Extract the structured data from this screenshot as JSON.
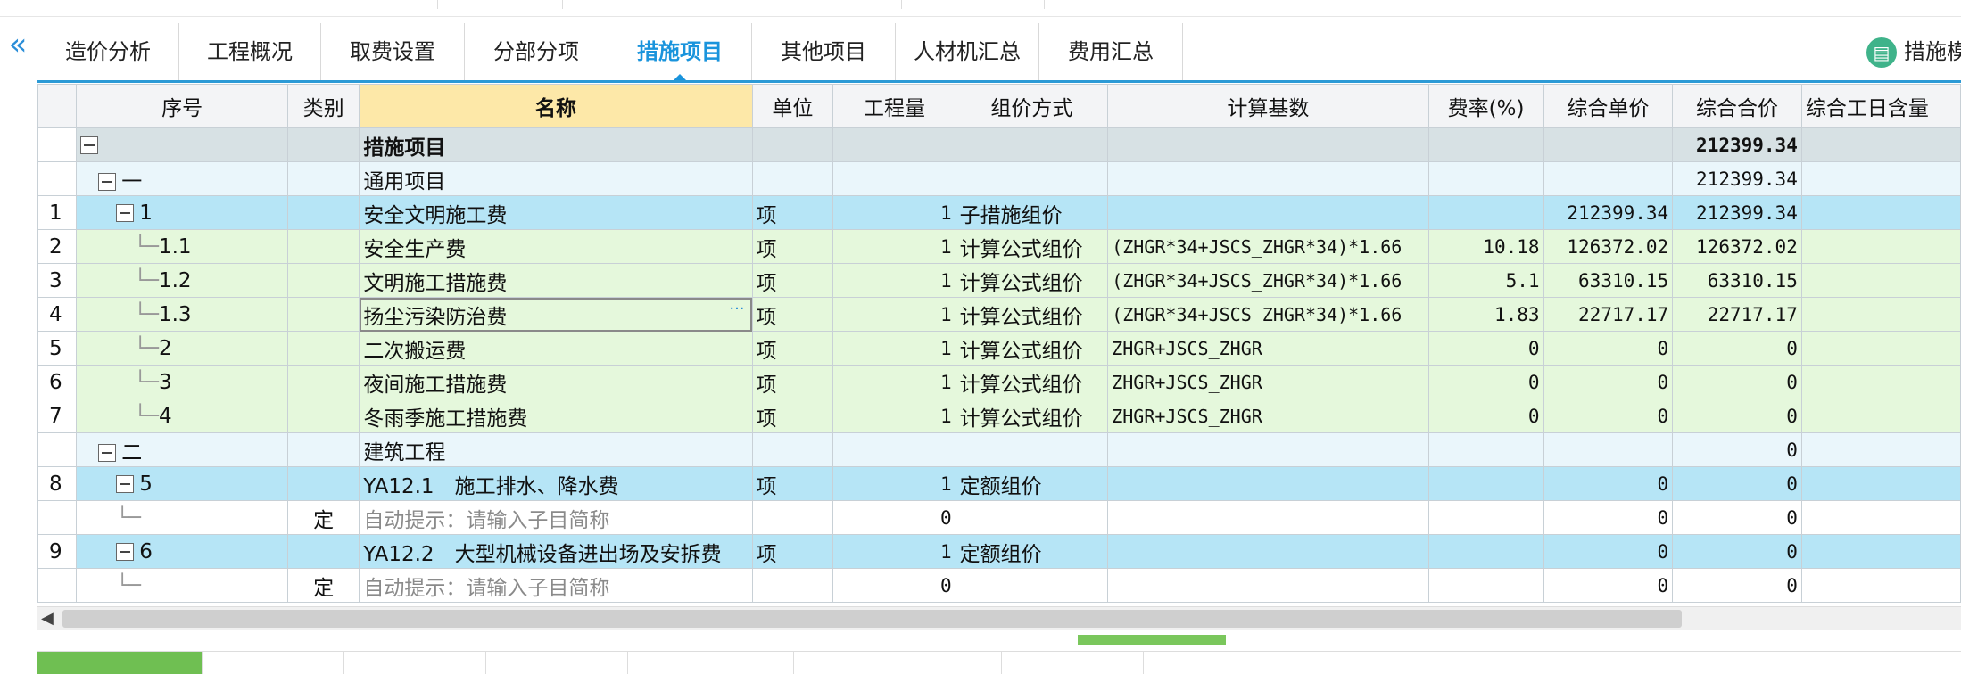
{
  "tabs": [
    {
      "label": "造价分析"
    },
    {
      "label": "工程概况"
    },
    {
      "label": "取费设置"
    },
    {
      "label": "分部分项"
    },
    {
      "label": "措施项目",
      "active": true
    },
    {
      "label": "其他项目"
    },
    {
      "label": "人材机汇总"
    },
    {
      "label": "费用汇总"
    }
  ],
  "top_right": {
    "label": "措施模",
    "icon": "book-icon"
  },
  "collapse_icon": "double-chevron-left-icon",
  "columns": [
    "序号",
    "类别",
    "名称",
    "单位",
    "工程量",
    "组价方式",
    "计算基数",
    "费率(%)",
    "综合单价",
    "综合合价",
    "综合工日含量"
  ],
  "rows": [
    {
      "no": "",
      "code": "",
      "type": "",
      "name": "措施项目",
      "unit": "",
      "qty": "",
      "method": "",
      "base": "",
      "rate": "",
      "price": "",
      "total": "212399.34",
      "level": "level0",
      "bold": true
    },
    {
      "no": "",
      "code": "一",
      "type": "",
      "name": "通用项目",
      "unit": "",
      "qty": "",
      "method": "",
      "base": "",
      "rate": "",
      "price": "",
      "total": "212399.34",
      "level": "level1"
    },
    {
      "no": "1",
      "code": "1",
      "type": "",
      "name": "安全文明施工费",
      "unit": "项",
      "qty": "1",
      "method": "子措施组价",
      "base": "",
      "rate": "",
      "price": "212399.34",
      "total": "212399.34",
      "level": "level2"
    },
    {
      "no": "2",
      "code": "1.1",
      "type": "",
      "name": "安全生产费",
      "unit": "项",
      "qty": "1",
      "method": "计算公式组价",
      "base": "(ZHGR*34+JSCS_ZHGR*34)*1.66",
      "rate": "10.18",
      "price": "126372.02",
      "total": "126372.02",
      "level": "level3"
    },
    {
      "no": "3",
      "code": "1.2",
      "type": "",
      "name": "文明施工措施费",
      "unit": "项",
      "qty": "1",
      "method": "计算公式组价",
      "base": "(ZHGR*34+JSCS_ZHGR*34)*1.66",
      "rate": "5.1",
      "price": "63310.15",
      "total": "63310.15",
      "level": "level3"
    },
    {
      "no": "4",
      "code": "1.3",
      "type": "",
      "name": "扬尘污染防治费",
      "unit": "项",
      "qty": "1",
      "method": "计算公式组价",
      "base": "(ZHGR*34+JSCS_ZHGR*34)*1.66",
      "rate": "1.83",
      "price": "22717.17",
      "total": "22717.17",
      "level": "level3",
      "selected": true
    },
    {
      "no": "5",
      "code": "2",
      "type": "",
      "name": "二次搬运费",
      "unit": "项",
      "qty": "1",
      "method": "计算公式组价",
      "base": "ZHGR+JSCS_ZHGR",
      "rate": "0",
      "price": "0",
      "total": "0",
      "level": "level3"
    },
    {
      "no": "6",
      "code": "3",
      "type": "",
      "name": "夜间施工措施费",
      "unit": "项",
      "qty": "1",
      "method": "计算公式组价",
      "base": "ZHGR+JSCS_ZHGR",
      "rate": "0",
      "price": "0",
      "total": "0",
      "level": "level3"
    },
    {
      "no": "7",
      "code": "4",
      "type": "",
      "name": "冬雨季施工措施费",
      "unit": "项",
      "qty": "1",
      "method": "计算公式组价",
      "base": "ZHGR+JSCS_ZHGR",
      "rate": "0",
      "price": "0",
      "total": "0",
      "level": "level3"
    },
    {
      "no": "",
      "code": "二",
      "type": "",
      "name": "建筑工程",
      "unit": "",
      "qty": "",
      "method": "",
      "base": "",
      "rate": "",
      "price": "",
      "total": "0",
      "level": "level1"
    },
    {
      "no": "8",
      "code": "5",
      "type": "",
      "name": "YA12.1　施工排水、降水费",
      "unit": "项",
      "qty": "1",
      "method": "定额组价",
      "base": "",
      "rate": "",
      "price": "0",
      "total": "0",
      "level": "level2"
    },
    {
      "no": "",
      "code": "",
      "type": "定",
      "name": "自动提示：请输入子目简称",
      "unit": "",
      "qty": "0",
      "method": "",
      "base": "",
      "rate": "",
      "price": "0",
      "total": "0",
      "level": "subline",
      "hint": true
    },
    {
      "no": "9",
      "code": "6",
      "type": "",
      "name": "YA12.2　大型机械设备进出场及安拆费",
      "unit": "项",
      "qty": "1",
      "method": "定额组价",
      "base": "",
      "rate": "",
      "price": "0",
      "total": "0",
      "level": "level2"
    },
    {
      "no": "",
      "code": "",
      "type": "定",
      "name": "自动提示：请输入子目简称",
      "unit": "",
      "qty": "0",
      "method": "",
      "base": "",
      "rate": "",
      "price": "0",
      "total": "0",
      "level": "subline",
      "hint": true
    }
  ]
}
